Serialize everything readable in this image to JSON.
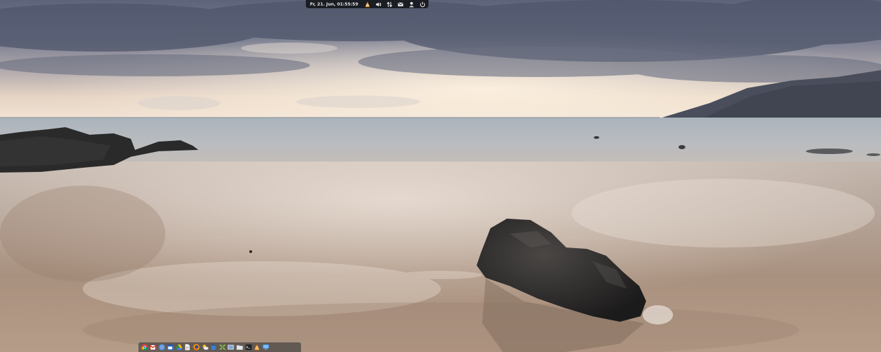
{
  "top_panel": {
    "clock": "Fr, 21. Jun, 01:55:59",
    "tray_icons": [
      "vlc-icon",
      "volume-icon",
      "network-transfer-icon",
      "mail-icon",
      "user-icon",
      "power-icon"
    ]
  },
  "dock": {
    "items": [
      "chrome-icon",
      "gmail-icon",
      "chromium-icon",
      "calendar-icon",
      "google-drive-icon",
      "document-icon",
      "firefox-icon",
      "weather-icon",
      "software-store-icon",
      "tools-icon",
      "screenshot-icon",
      "files-icon",
      "terminal-icon",
      "vlc-icon",
      "monitor-icon"
    ]
  },
  "colors": {
    "panel_bg": "#16181c",
    "panel_text": "#e8e8e8",
    "vlc_orange": "#f08a00",
    "sand": "#b9a594",
    "sky": "#6f7688"
  }
}
